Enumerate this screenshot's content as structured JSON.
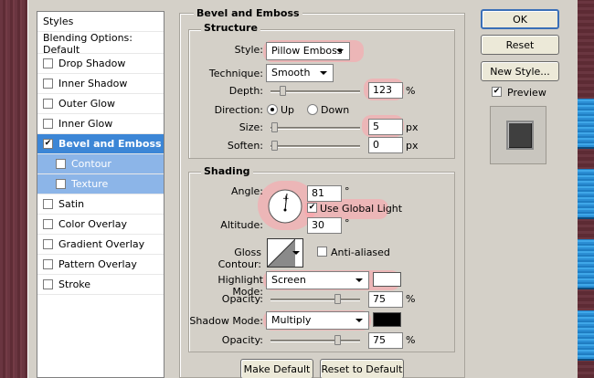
{
  "styles_panel": {
    "title": "Styles",
    "blending_options": "Blending Options: Default",
    "items": [
      {
        "label": "Drop Shadow",
        "checked": false
      },
      {
        "label": "Inner Shadow",
        "checked": false
      },
      {
        "label": "Outer Glow",
        "checked": false
      },
      {
        "label": "Inner Glow",
        "checked": false
      },
      {
        "label": "Bevel and Emboss",
        "checked": true
      },
      {
        "label": "Contour",
        "checked": false
      },
      {
        "label": "Texture",
        "checked": false
      },
      {
        "label": "Satin",
        "checked": false
      },
      {
        "label": "Color Overlay",
        "checked": false
      },
      {
        "label": "Gradient Overlay",
        "checked": false
      },
      {
        "label": "Pattern Overlay",
        "checked": false
      },
      {
        "label": "Stroke",
        "checked": false
      }
    ]
  },
  "bevel": {
    "title": "Bevel and Emboss",
    "structure": {
      "title": "Structure",
      "style_label": "Style:",
      "style_value": "Pillow Emboss",
      "technique_label": "Technique:",
      "technique_value": "Smooth",
      "depth_label": "Depth:",
      "depth_value": "123",
      "depth_unit": "%",
      "direction_label": "Direction:",
      "direction_up": "Up",
      "direction_down": "Down",
      "size_label": "Size:",
      "size_value": "5",
      "size_unit": "px",
      "soften_label": "Soften:",
      "soften_value": "0",
      "soften_unit": "px"
    },
    "shading": {
      "title": "Shading",
      "angle_label": "Angle:",
      "angle_value": "81",
      "angle_unit": "°",
      "global_light_label": "Use Global Light",
      "altitude_label": "Altitude:",
      "altitude_value": "30",
      "altitude_unit": "°",
      "gloss_label": "Gloss Contour:",
      "antialiased_label": "Anti-aliased",
      "highlight_label": "Highlight Mode:",
      "highlight_value": "Screen",
      "highlight_opacity_label": "Opacity:",
      "highlight_opacity_value": "75",
      "highlight_opacity_unit": "%",
      "shadow_label": "Shadow Mode:",
      "shadow_value": "Multiply",
      "shadow_opacity_label": "Opacity:",
      "shadow_opacity_value": "75",
      "shadow_opacity_unit": "%"
    },
    "make_default": "Make Default",
    "reset_default": "Reset to Default"
  },
  "actions": {
    "ok": "OK",
    "reset": "Reset",
    "new_style": "New Style...",
    "preview_label": "Preview"
  },
  "colors": {
    "selection": "#3c86d6",
    "highlight_swatch": "#ffffff",
    "shadow_swatch": "#000000",
    "annotation": "#ffa0aa"
  }
}
